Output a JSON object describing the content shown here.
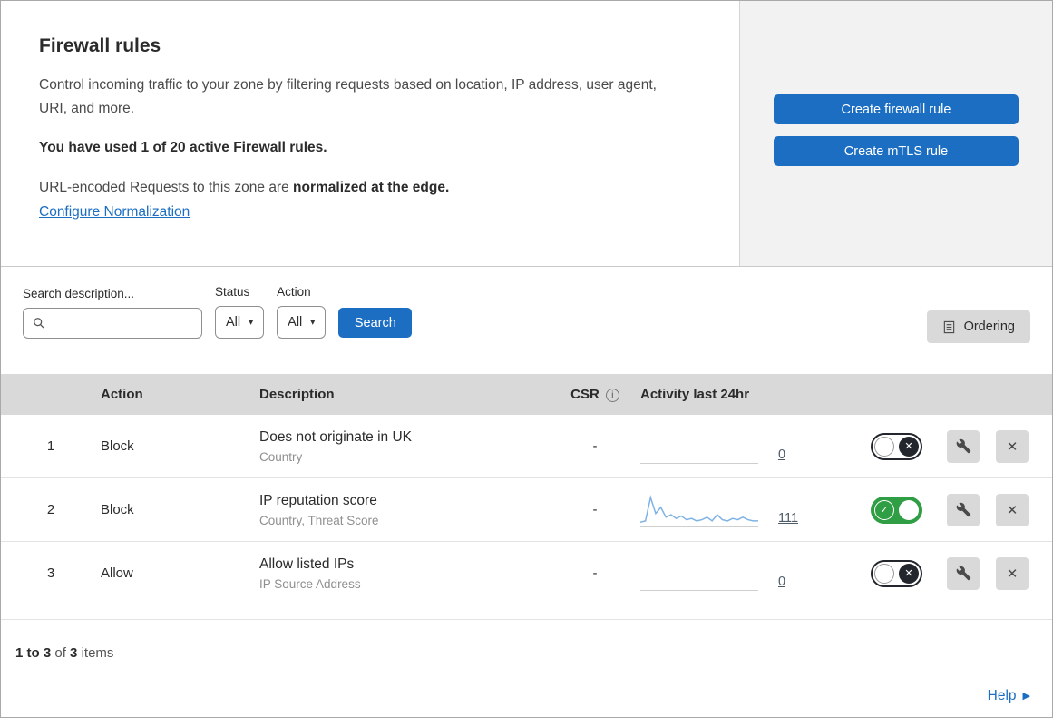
{
  "header": {
    "title": "Firewall rules",
    "description": "Control incoming traffic to your zone by filtering requests based on location, IP address, user agent, URI, and more.",
    "usage": "You have used 1 of 20 active Firewall rules.",
    "normalization_prefix": "URL-encoded Requests to this zone are ",
    "normalization_bold": "normalized at the edge.",
    "normalization_link": "Configure Normalization",
    "buttons": {
      "create_firewall": "Create firewall rule",
      "create_mtls": "Create mTLS rule"
    }
  },
  "filters": {
    "search_label": "Search description...",
    "search_value": "",
    "status_label": "Status",
    "status_value": "All",
    "action_label": "Action",
    "action_value": "All",
    "search_button": "Search",
    "ordering_button": "Ordering"
  },
  "table": {
    "columns": {
      "action": "Action",
      "description": "Description",
      "csr": "CSR",
      "activity": "Activity last 24hr"
    },
    "rows": [
      {
        "priority": "1",
        "action": "Block",
        "description": "Does not originate in UK",
        "fields": "Country",
        "csr": "-",
        "activity_count": "0",
        "enabled": false,
        "sparkline": []
      },
      {
        "priority": "2",
        "action": "Block",
        "description": "IP reputation score",
        "fields": "Country, Threat Score",
        "csr": "-",
        "activity_count": "111",
        "enabled": true,
        "sparkline": [
          2,
          3,
          22,
          9,
          14,
          6,
          8,
          5,
          7,
          4,
          5,
          3,
          4,
          6,
          3,
          8,
          4,
          3,
          5,
          4,
          6,
          4,
          3,
          3
        ]
      },
      {
        "priority": "3",
        "action": "Allow",
        "description": "Allow listed IPs",
        "fields": "IP Source Address",
        "csr": "-",
        "activity_count": "0",
        "enabled": false,
        "sparkline": []
      }
    ]
  },
  "footer": {
    "range": "1 to 3",
    "of": "of",
    "total": "3",
    "items": "items"
  },
  "help_label": "Help",
  "icons": {
    "info": "i",
    "caret": "▾",
    "help_arrow": "▶",
    "close": "✕"
  },
  "colors": {
    "accent_blue": "#1b6ec2",
    "toggle_green": "#2f9e44",
    "sparkline_blue": "#7fb2e5"
  }
}
